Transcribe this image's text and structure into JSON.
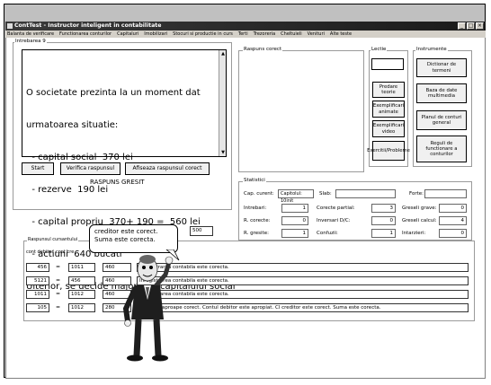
{
  "window": {
    "title": "ContTest - Instructor inteligent in contabilitate",
    "min": "_",
    "max": "□",
    "close": "×"
  },
  "menu": [
    "Balanta de verificare",
    "Functionarea conturilor",
    "Capitaluri",
    "Imobilizari",
    "Stocuri si productie in curs",
    "Terti",
    "Trezoreria",
    "Cheltuieli",
    "Venituri",
    "Alte teste"
  ],
  "question": {
    "label": "Intrebarea 9",
    "lines": [
      "O societate prezinta la un moment dat",
      "urmatoarea situatie:",
      "  - capital social  370 lei",
      "  - rezerve  190 lei",
      "  - capital propriu  370+ 190 =  560 lei",
      "  - actiuni  640 bucati",
      "Ulterior, se decide majorarea capitalului social"
    ]
  },
  "buttons": {
    "start": "Start",
    "verify": "Verifica raspunsul",
    "show": "Afiseaza raspunsul corect"
  },
  "result": "RASPUNS GRESIT",
  "correct_answer": {
    "label": "Raspuns corect"
  },
  "lectie": {
    "label": "Lectie",
    "predare": "Predare teorie",
    "animate": "Exemplificari animate",
    "video": "Exemplificari video",
    "exercitii": "Exercitii/Probleme"
  },
  "instruments": {
    "label": "Instrumente",
    "dictionary": "Dictionar de termeni",
    "multimedia": "Baza de date multimedia",
    "plan": "Planul de conturi general",
    "rules": "Reguli de functionare a conturilor"
  },
  "stats": {
    "label": "Statistici",
    "cap_label": "Cap. curent:",
    "cap_value": "Capitolul: 10init",
    "slab": "Slab:",
    "forte": "Forte:",
    "intrebari_l": "Intrebari:",
    "intrebari": "1",
    "corecte_p_l": "Corecte partial:",
    "corecte_p": "3",
    "gr_grave_l": "Greseli grave:",
    "gr_grave": "0",
    "r_corecte_l": "R. corecte:",
    "r_corecte": "0",
    "inv_l": "Inversari D/C:",
    "inv": "0",
    "gr_calc_l": "Greseli calcul:",
    "gr_calc": "4",
    "r_gresite_l": "R. gresite:",
    "r_gresite": "1",
    "conf_l": "Confuzii:",
    "conf": "1",
    "int_l": "Intarzieri:",
    "int": "0"
  },
  "answer": {
    "label": "Raspunsul cursantului",
    "col_debit": "cont debitor",
    "col_credit": "cont cre",
    "extra_value": "500",
    "rows": [
      {
        "debit": "456",
        "credit": "1011",
        "sum": "460",
        "msg": "Inregistrarea contabila este corecta."
      },
      {
        "debit": "5121",
        "credit": "456",
        "sum": "460",
        "msg": "Inregistrarea contabila este corecta."
      },
      {
        "debit": "1011",
        "credit": "1012",
        "sum": "460",
        "msg": "Inregistrarea contabila este corecta."
      },
      {
        "debit": "105",
        "credit": "1012",
        "sum": "280",
        "msg": "Raspuns aproape corect. Contul debitor este apropiat. Cl creditor este corect. Suma este corecta."
      }
    ],
    "eq": "="
  },
  "bubble": {
    "text": "creditor este corect. Suma este corecta."
  }
}
